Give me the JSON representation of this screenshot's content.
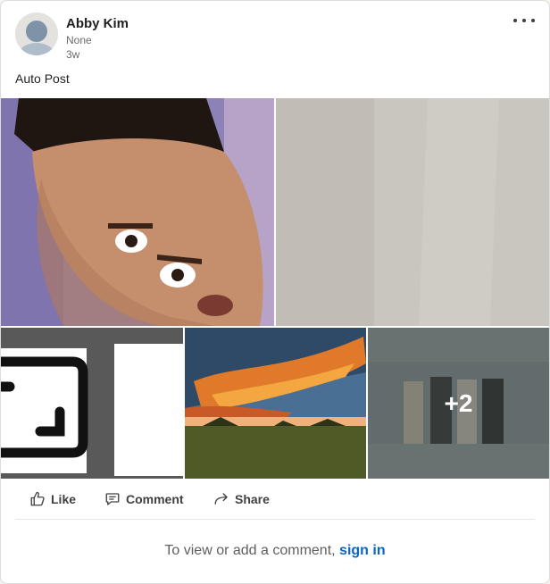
{
  "post": {
    "author": {
      "name": "Abby Kim",
      "headline": "None",
      "time": "3w"
    },
    "text": "Auto Post",
    "media": {
      "extra_count_label": "+2"
    },
    "actions": {
      "like": "Like",
      "comment": "Comment",
      "share": "Share"
    },
    "signin": {
      "prefix": "To view or add a comment,",
      "link": "sign in"
    }
  },
  "colors": {
    "link": "#0a66c2",
    "overlay": "#404846"
  }
}
